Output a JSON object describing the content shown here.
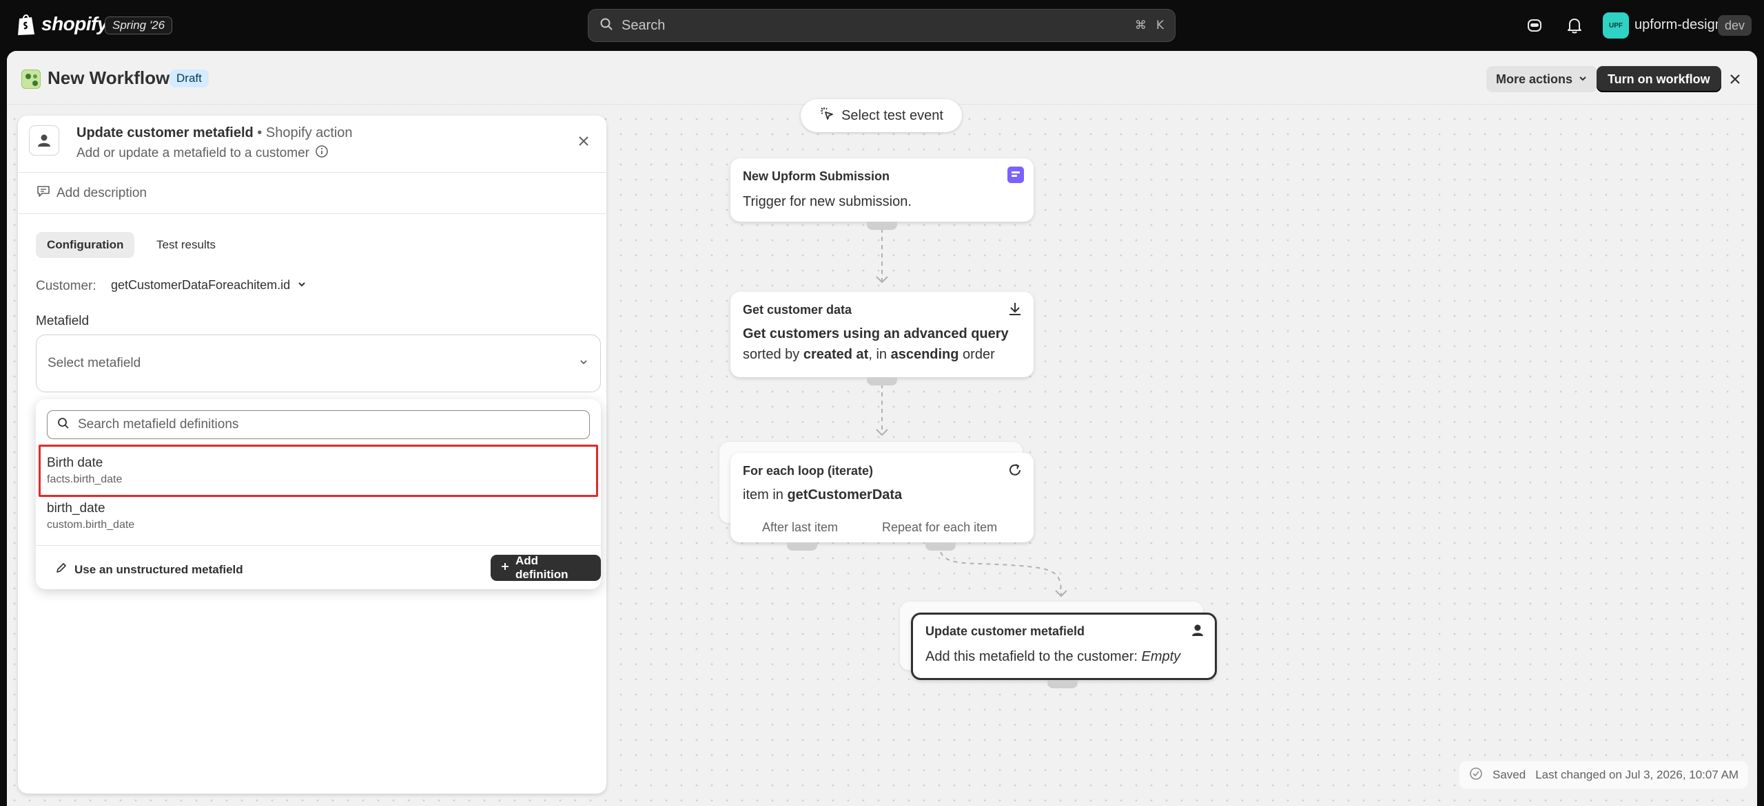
{
  "topbar": {
    "brand": "shopify",
    "edition": "Spring '26",
    "search_placeholder": "Search",
    "shortcut_mod": "⌘",
    "shortcut_key": "K",
    "avatar_initials": "UPF",
    "store_name": "upform-design",
    "env_badge": "dev"
  },
  "header": {
    "title": "New Workflow",
    "status_badge": "Draft",
    "more_actions": "More actions",
    "primary_action": "Turn on workflow"
  },
  "panel": {
    "title": "Update customer metafield",
    "separator": "•",
    "action_type": "Shopify action",
    "subtitle": "Add or update a metafield to a customer",
    "add_description": "Add description",
    "tabs": [
      {
        "label": "Configuration",
        "active": true
      },
      {
        "label": "Test results",
        "active": false
      }
    ],
    "customer_label": "Customer:",
    "customer_value": "getCustomerDataForeachitem.id",
    "metafield_label": "Metafield",
    "select_placeholder": "Select metafield",
    "dropdown": {
      "search_placeholder": "Search metafield definitions",
      "items": [
        {
          "name": "Birth date",
          "key": "facts.birth_date",
          "highlighted": true
        },
        {
          "name": "birth_date",
          "key": "custom.birth_date",
          "highlighted": false
        }
      ],
      "unstructured_label": "Use an unstructured metafield",
      "add_definition_label": "Add definition"
    }
  },
  "canvas": {
    "test_event": "Select test event",
    "nodes": [
      {
        "title": "New Upform Submission",
        "body_plain": "Trigger for new submission."
      },
      {
        "title": "Get customer data",
        "body_bold_1": "Get customers using an advanced query",
        "body_part_1": "sorted by ",
        "body_bold_2": "created at",
        "body_part_2": ", in ",
        "body_bold_3": "ascending",
        "body_part_3": " order"
      },
      {
        "title": "For each loop (iterate)",
        "body_part_1": "item in ",
        "body_bold_1": "getCustomerData",
        "branch_left": "After last item",
        "branch_right": "Repeat for each item"
      },
      {
        "title": "Update customer metafield",
        "body_part_1": "Add this metafield to the customer: ",
        "body_italic": "Empty"
      }
    ]
  },
  "status": {
    "saved": "Saved",
    "last_changed": "Last changed on Jul 3, 2026, 10:07 AM"
  },
  "colors": {
    "accent_dark": "#303030",
    "draft_badge_bg": "#d5ebff",
    "highlight_border": "#e22a2a",
    "avatar_bg": "#2fd3c3",
    "upform_icon": "#7b61ff"
  }
}
